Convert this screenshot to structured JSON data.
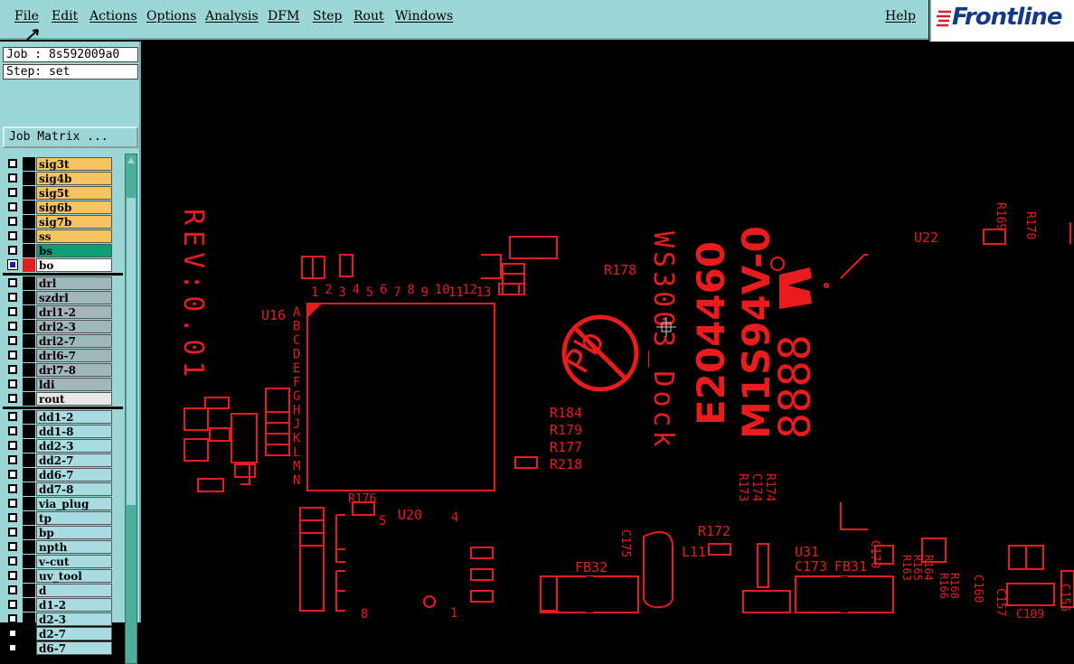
{
  "menu": {
    "file": "File",
    "edit": "Edit",
    "actions": "Actions",
    "options": "Options",
    "analysis": "Analysis",
    "dfm": "DFM",
    "step": "Step",
    "rout": "Rout",
    "windows": "Windows",
    "help": "Help"
  },
  "logo": {
    "text": "Frontline"
  },
  "job": {
    "label": "Job : 8s592009a0"
  },
  "step": {
    "label": "Step: set"
  },
  "job_matrix": {
    "label": "Job Matrix ..."
  },
  "layers": {
    "signal": [
      {
        "name": "sig3t"
      },
      {
        "name": "sig4b"
      },
      {
        "name": "sig5t"
      },
      {
        "name": "sig6b"
      },
      {
        "name": "sig7b"
      },
      {
        "name": "ss"
      },
      {
        "name": "bs"
      },
      {
        "name": "bo"
      }
    ],
    "drill": [
      {
        "name": "drl"
      },
      {
        "name": "szdrl"
      },
      {
        "name": "drl1-2"
      },
      {
        "name": "drl2-3"
      },
      {
        "name": "drl2-7"
      },
      {
        "name": "drl6-7"
      },
      {
        "name": "drl7-8"
      },
      {
        "name": "ldi"
      },
      {
        "name": "rout"
      }
    ],
    "doc": [
      {
        "name": "dd1-2"
      },
      {
        "name": "dd1-8"
      },
      {
        "name": "dd2-3"
      },
      {
        "name": "dd2-7"
      },
      {
        "name": "dd6-7"
      },
      {
        "name": "dd7-8"
      },
      {
        "name": "via_plug"
      },
      {
        "name": "tp"
      },
      {
        "name": "bp"
      },
      {
        "name": "npth"
      },
      {
        "name": "v-cut"
      },
      {
        "name": "uv_tool"
      },
      {
        "name": "d"
      },
      {
        "name": "d1-2"
      },
      {
        "name": "d2-3"
      },
      {
        "name": "d2-7"
      },
      {
        "name": "d6-7"
      }
    ]
  },
  "colors": {
    "menu_bg": "#9dd6d6",
    "board_trace": "#e81c1c",
    "canvas_bg": "#000000",
    "logo_blue": "#123a8a"
  },
  "board_text": {
    "rev": "REV:0.01",
    "ws": "WS3003_Dock",
    "e": "E204460",
    "m": "M1S94V-0",
    "date": "8888",
    "u16": "U16",
    "u20": "U20",
    "u22": "U22",
    "u31": "U31",
    "r178": "R178",
    "r184": "R184",
    "r179": "R179",
    "r177": "R177",
    "r218": "R218",
    "r176": "R176",
    "r172": "R172",
    "r169": "R169",
    "r170": "R170",
    "r173": "R173",
    "c174": "C174",
    "r174": "R174",
    "fb32": "FB32",
    "fb31": "FB31",
    "c175": "C175",
    "l11": "L11",
    "c173": "C173",
    "c170": "C170",
    "r163": "R163",
    "r165": "R165",
    "r164": "R164",
    "r166": "R166",
    "r168": "R168",
    "c160": "C160",
    "c157": "C157",
    "c109": "C109",
    "c155": "C155",
    "pb": "Pb",
    "cols": [
      "1",
      "2",
      "3",
      "4",
      "5",
      "6",
      "7",
      "8",
      "9",
      "10",
      "11",
      "12",
      "13"
    ],
    "rows": [
      "A",
      "B",
      "C",
      "D",
      "E",
      "F",
      "G",
      "H",
      "J",
      "K",
      "L",
      "M",
      "N"
    ],
    "n5": "5",
    "n4": "4",
    "n8": "8",
    "n1": "1"
  }
}
